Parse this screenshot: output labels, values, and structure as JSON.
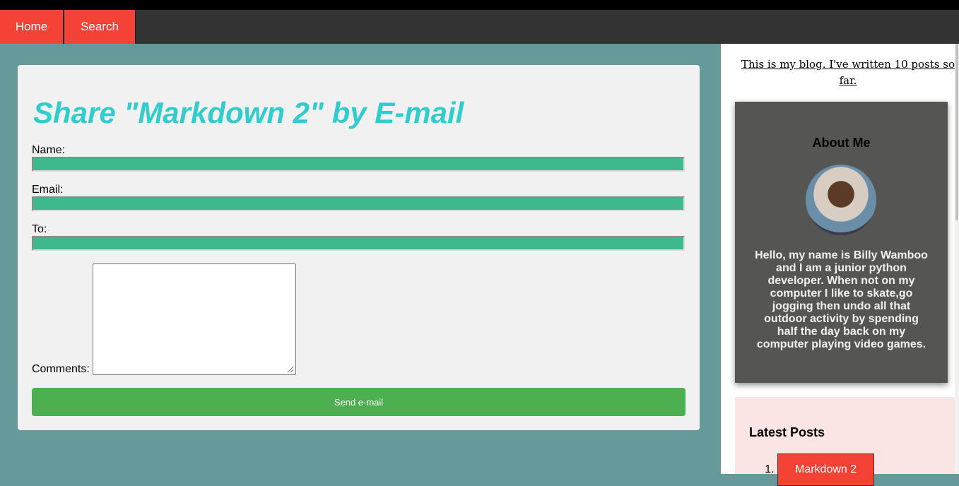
{
  "nav": {
    "home_label": "Home",
    "search_label": "Search"
  },
  "share_form": {
    "title": "Share \"Markdown 2\" by E-mail",
    "name_label": "Name:",
    "name_value": "",
    "email_label": "Email:",
    "email_value": "",
    "to_label": "To:",
    "to_value": "",
    "comments_label": "Comments:",
    "comments_value": "",
    "submit_label": "Send e-mail"
  },
  "sidebar": {
    "blurb": "This is my blog. I've written 10 posts so far.",
    "about": {
      "heading": "About Me",
      "bio": "Hello, my name is Billy Wamboo and I am a junior python developer. When not on my computer I like to skate,go jogging then undo all that outdoor activity by spending half the day back on my computer playing video games."
    },
    "latest_posts": {
      "heading": "Latest Posts",
      "items": [
        {
          "label": "Markdown 2"
        }
      ]
    }
  },
  "colors": {
    "nav_accent": "#f44336",
    "navbar_bg": "#333333",
    "page_bg": "#669999",
    "title_color": "#33cccc",
    "field_bg": "#3cba8b",
    "submit_bg": "#4caf50",
    "about_bg": "#555553",
    "latest_bg": "#fbe4e4"
  }
}
